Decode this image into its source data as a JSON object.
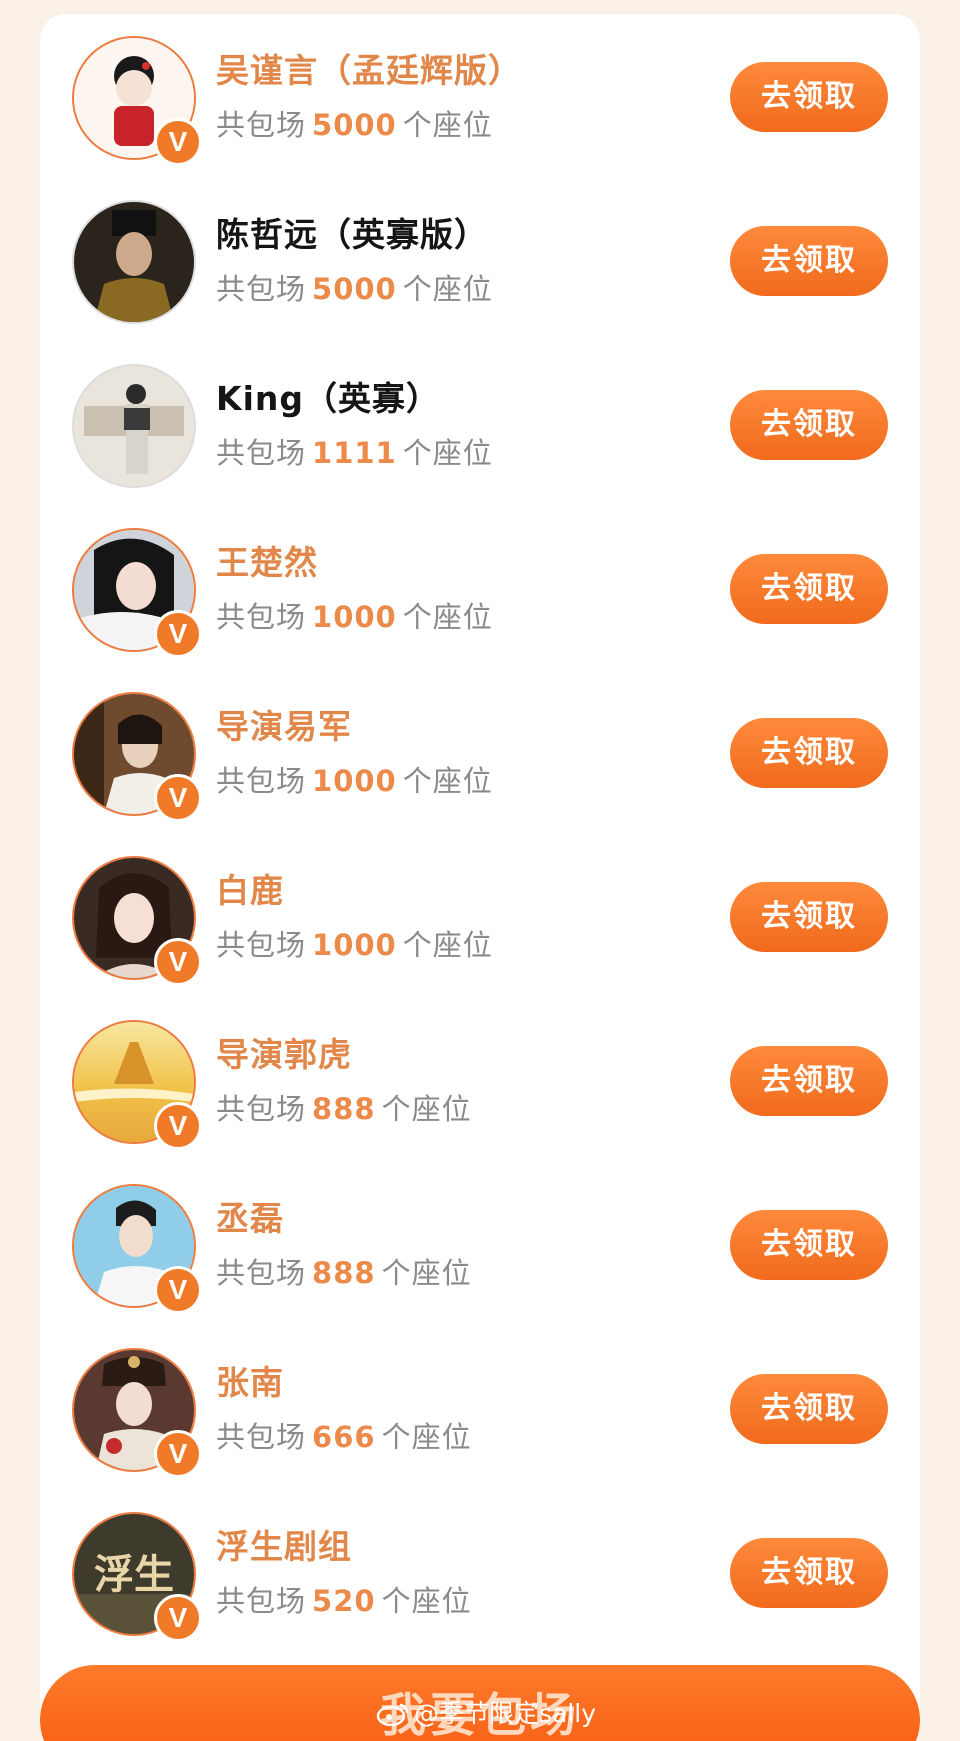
{
  "rows": [
    {
      "name": "吴谨言（孟廷辉版）",
      "prefix": "共包场",
      "seats": "5000",
      "suffix": "个座位",
      "button": "去领取",
      "verified": "V"
    },
    {
      "name": "陈哲远（英寡版）",
      "prefix": "共包场",
      "seats": "5000",
      "suffix": "个座位",
      "button": "去领取",
      "verified": ""
    },
    {
      "name": "King（英寡）",
      "prefix": "共包场",
      "seats": "1111",
      "suffix": "个座位",
      "button": "去领取",
      "verified": ""
    },
    {
      "name": "王楚然",
      "prefix": "共包场",
      "seats": "1000",
      "suffix": "个座位",
      "button": "去领取",
      "verified": "V"
    },
    {
      "name": "导演易军",
      "prefix": "共包场",
      "seats": "1000",
      "suffix": "个座位",
      "button": "去领取",
      "verified": "V"
    },
    {
      "name": "白鹿",
      "prefix": "共包场",
      "seats": "1000",
      "suffix": "个座位",
      "button": "去领取",
      "verified": "V"
    },
    {
      "name": "导演郭虎",
      "prefix": "共包场",
      "seats": "888",
      "suffix": "个座位",
      "button": "去领取",
      "verified": "V"
    },
    {
      "name": "丞磊",
      "prefix": "共包场",
      "seats": "888",
      "suffix": "个座位",
      "button": "去领取",
      "verified": "V"
    },
    {
      "name": "张南",
      "prefix": "共包场",
      "seats": "666",
      "suffix": "个座位",
      "button": "去领取",
      "verified": "V"
    },
    {
      "name": "浮生剧组",
      "prefix": "共包场",
      "seats": "520",
      "suffix": "个座位",
      "button": "去领取",
      "verified": "V"
    }
  ],
  "bottom_button": {
    "label": "我要包场"
  },
  "watermark": {
    "text": "@季节限定sally"
  },
  "avatar_art": {
    "row_10_text": "浮生"
  },
  "colors": {
    "accent": "#f07a28",
    "name_highlight": "#e2874a",
    "button": "#f06a1c"
  }
}
